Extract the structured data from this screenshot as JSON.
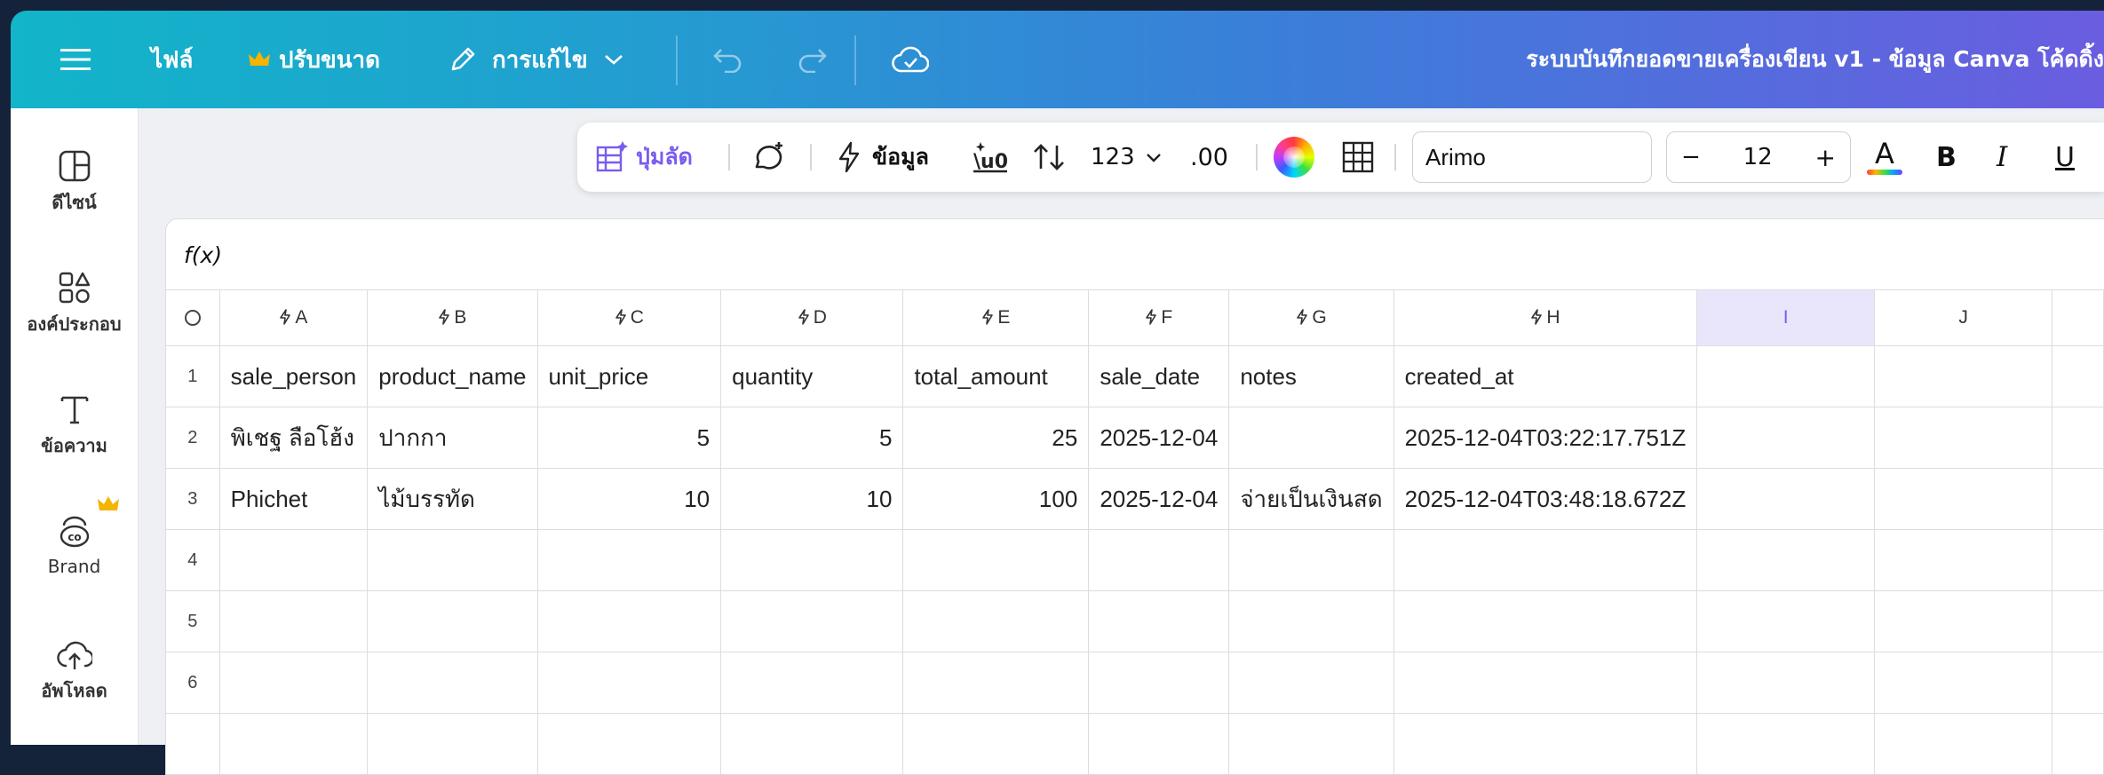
{
  "topbar": {
    "file_menu": "ไฟล์",
    "resize_menu": "ปรับขนาด",
    "edit_menu": "การแก้ไข",
    "document_title": "ระบบบันทึกยอดขายเครื่องเขียน v1 - ข้อมูล Canva โค้ดดิ้ง"
  },
  "sidebar": {
    "items": [
      {
        "label": "ดีไซน์",
        "icon": "layout-icon"
      },
      {
        "label": "องค์ประกอบ",
        "icon": "shapes-icon"
      },
      {
        "label": "ข้อความ",
        "icon": "text-icon"
      },
      {
        "label": "Brand",
        "icon": "brand-icon"
      },
      {
        "label": "อัพโหลด",
        "icon": "cloud-upload-icon"
      }
    ]
  },
  "toolbar": {
    "shortcut_label": "ปุ่มลัด",
    "data_label": "ข้อมูล",
    "number_format": "123",
    "decimal_label": ".00",
    "font_name": "Arimo",
    "font_size": "12",
    "minus_label": "−",
    "plus_label": "+",
    "font_color_letter": "A",
    "bold_label": "B",
    "italic_label": "I",
    "underline_label": "U"
  },
  "formula_bar": {
    "label": "f(x)"
  },
  "sheet": {
    "columns": [
      "A",
      "B",
      "C",
      "D",
      "E",
      "F",
      "G",
      "H",
      "I",
      "J"
    ],
    "selected_column": "I",
    "rows": [
      {
        "n": "1",
        "cells": [
          "sale_person",
          "product_name",
          "unit_price",
          "quantity",
          "total_amount",
          "sale_date",
          "notes",
          "created_at",
          "",
          ""
        ]
      },
      {
        "n": "2",
        "cells": [
          "พิเชฐ ลือโฮ้ง",
          "ปากกา",
          "5",
          "5",
          "25",
          "2025-12-04",
          "",
          "2025-12-04T03:22:17.751Z",
          "",
          ""
        ]
      },
      {
        "n": "3",
        "cells": [
          "Phichet",
          "ไม้บรรทัด",
          "10",
          "10",
          "100",
          "2025-12-04",
          "จ่ายเป็นเงินสด",
          "2025-12-04T03:48:18.672Z",
          "",
          ""
        ]
      },
      {
        "n": "4",
        "cells": [
          "",
          "",
          "",
          "",
          "",
          "",
          "",
          "",
          "",
          ""
        ]
      },
      {
        "n": "5",
        "cells": [
          "",
          "",
          "",
          "",
          "",
          "",
          "",
          "",
          "",
          ""
        ]
      },
      {
        "n": "6",
        "cells": [
          "",
          "",
          "",
          "",
          "",
          "",
          "",
          "",
          "",
          ""
        ]
      }
    ]
  },
  "colors": {
    "accent": "#7a5cf0",
    "crown": "#f5b400"
  }
}
